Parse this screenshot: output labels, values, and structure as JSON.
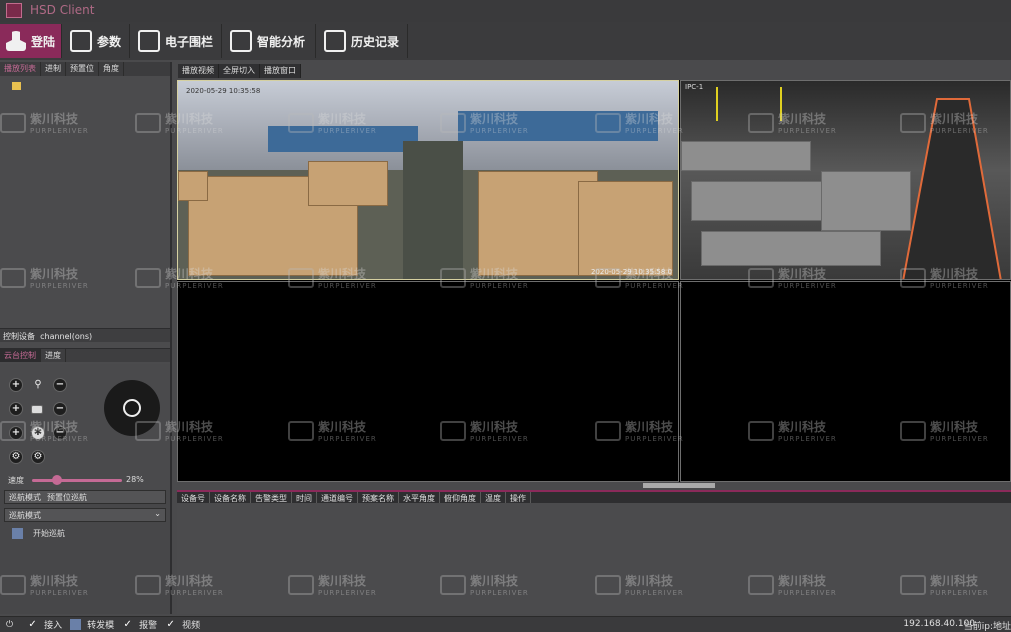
{
  "app": {
    "title": "HSD Client"
  },
  "main_tabs": [
    {
      "label": "登陆",
      "icon": "user-icon",
      "active": true
    },
    {
      "label": "参数",
      "icon": "clipboard-icon"
    },
    {
      "label": "电子围栏",
      "icon": "map-fence-icon"
    },
    {
      "label": "智能分析",
      "icon": "monitor-icon"
    },
    {
      "label": "历史记录",
      "icon": "document-icon"
    }
  ],
  "left_panel": {
    "tabs": [
      "播放列表",
      "进制",
      "预置位",
      "角度"
    ],
    "control_device_label": "控制设备",
    "control_device_value": "channel(ons)",
    "ptz_tabs": [
      "云台控制",
      "进度"
    ],
    "speed_label": "速度",
    "speed_value": "28%",
    "speed_fraction": 0.28,
    "cruise_row": [
      "巡航模式",
      "预置位巡航"
    ],
    "patrol_select": "巡航模式",
    "check_label": "开始巡航"
  },
  "video": {
    "tabs": [
      "播放视频",
      "全屏切入",
      "播放窗口"
    ],
    "cell1_overlay_top": "2020-05-29 10:35:58",
    "cell1_overlay_bottom": "2020-05-29 10:35:58 0",
    "cell2_overlay_top": "IPC-1"
  },
  "table": {
    "columns": [
      "设备号",
      "设备名称",
      "告警类型",
      "时间",
      "通道编号",
      "预案名称",
      "水平角度",
      "俯仰角度",
      "温度",
      "操作"
    ]
  },
  "statusbar": {
    "items": [
      {
        "label": "接入",
        "checked": true
      },
      {
        "label": "转发模",
        "checked": false
      },
      {
        "label": "报警",
        "checked": true
      },
      {
        "label": "视频",
        "checked": true
      }
    ],
    "ip": "192.168.40.100",
    "right_text": "当前ip:地址"
  },
  "watermark": {
    "cn": "紫川科技",
    "en": "PURPLERIVER"
  },
  "colors": {
    "accent": "#8a2a5a",
    "bg": "#4a4a4c"
  }
}
